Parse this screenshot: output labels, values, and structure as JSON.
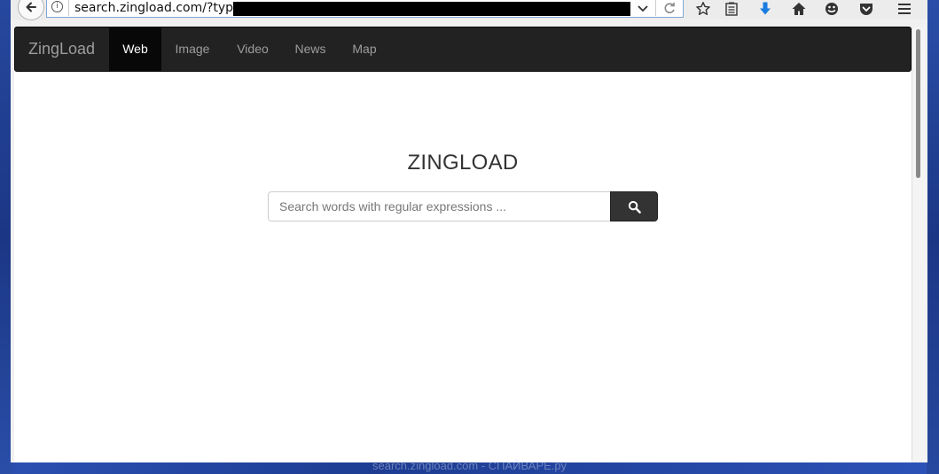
{
  "browser": {
    "url": "search.zingload.com/?type=",
    "info_glyph": "i",
    "toolbar_icons": [
      "star-icon",
      "reading-list-icon",
      "download-icon",
      "home-icon",
      "smiley-icon",
      "pocket-icon",
      "menu-icon"
    ]
  },
  "site": {
    "brand": "ZingLoad",
    "nav": [
      {
        "label": "Web",
        "active": true
      },
      {
        "label": "Image",
        "active": false
      },
      {
        "label": "Video",
        "active": false
      },
      {
        "label": "News",
        "active": false
      },
      {
        "label": "Map",
        "active": false
      }
    ],
    "title": "ZINGLOAD",
    "search": {
      "placeholder": "Search words with regular expressions ...",
      "value": ""
    }
  },
  "watermark": "search.zingload.com - СПАЙВАРЕ.ру",
  "colors": {
    "navbar_bg": "#222222",
    "active_nav_bg": "#080808",
    "download_blue": "#1a7be0",
    "desktop_blue": "#1c3a8a"
  }
}
